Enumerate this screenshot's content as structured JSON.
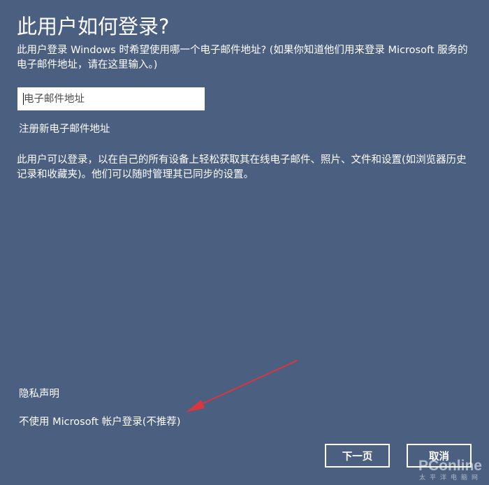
{
  "header": {
    "title": "此用户如何登录?"
  },
  "main": {
    "description": "此用户登录 Windows 时希望使用哪一个电子邮件地址? (如果你知道他们用来登录 Microsoft 服务的电子邮件地址，请在这里输入。)",
    "email_placeholder": "电子邮件地址",
    "register_link": "注册新电子邮件地址",
    "info_text": "此用户可以登录，以在自己的所有设备上轻松获取其在线电子邮件、照片、文件和设置(如浏览器历史记录和收藏夹)。他们可以随时管理其已同步的设置。"
  },
  "footer": {
    "privacy_link": "隐私声明",
    "no_account_link": "不使用 Microsoft 帐户登录(不推荐)",
    "next_button": "下一页",
    "cancel_button": "取消"
  },
  "watermark": {
    "brand": "PConline",
    "sub": "太平洋电脑网"
  },
  "colors": {
    "background": "#4b5f80",
    "arrow": "#d9363e"
  }
}
